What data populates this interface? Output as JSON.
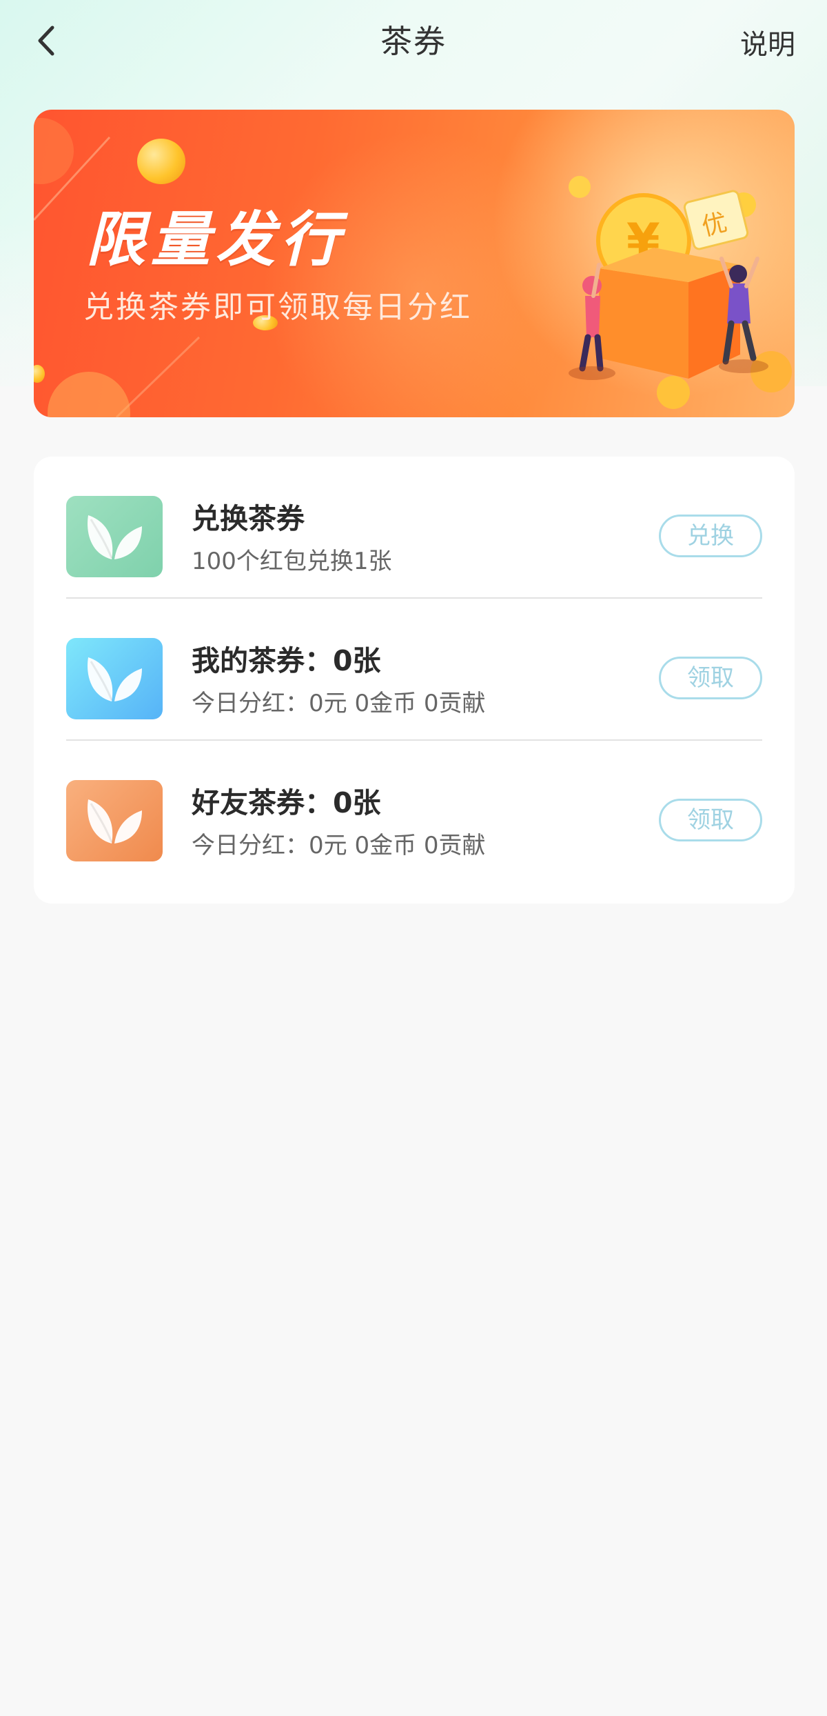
{
  "header": {
    "title": "茶券",
    "explain_label": "说明"
  },
  "banner": {
    "title": "限量发行",
    "subtitle": "兑换茶券即可领取每日分红",
    "badge_text": "优"
  },
  "vouchers": [
    {
      "title": "兑换茶券",
      "description": "100个红包兑换1张",
      "button_label": "兑换",
      "icon": "tea-leaf-icon",
      "icon_color": "#8ed8b6"
    },
    {
      "title": "我的茶券：0张",
      "description": "今日分红：0元 0金币 0贡献",
      "button_label": "领取",
      "icon": "tea-leaf-icon",
      "icon_color": "#66c6f9"
    },
    {
      "title": "好友茶券：0张",
      "description": "今日分红：0元  0金币 0贡献",
      "button_label": "领取",
      "icon": "tea-leaf-icon",
      "icon_color": "#f49c62"
    }
  ],
  "colors": {
    "background": "#f8f8f8",
    "banner_start": "#ff5530",
    "banner_end": "#ffb267",
    "button_border": "#a9dcea",
    "button_text": "#9fd2e2"
  }
}
